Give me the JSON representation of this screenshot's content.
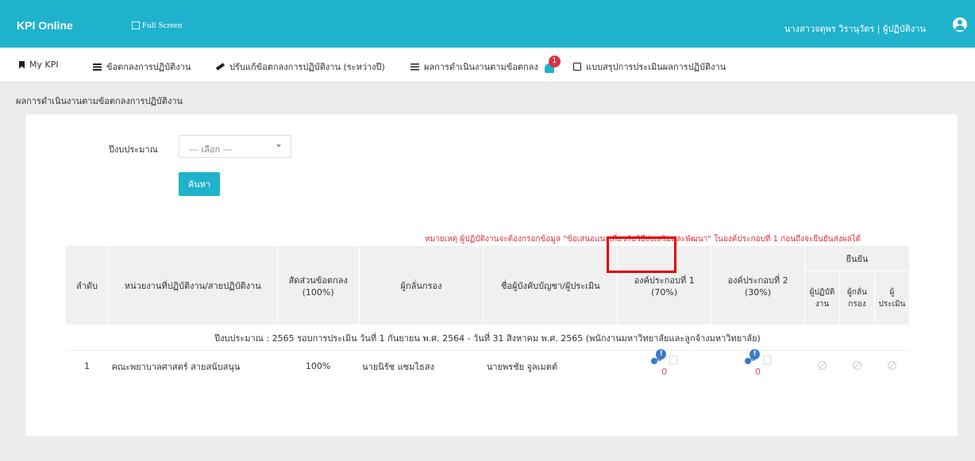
{
  "header": {
    "brand": "KPI Online",
    "fullscreen_label": "Full Screen",
    "user_name": "นางสาวจตุพร วิรานุวัตร | ผู้ปฏิบัติงาน"
  },
  "menu": [
    {
      "label": "My KPI",
      "icon": "bookmark-icon"
    },
    {
      "label": "ข้อตกลงการปฏิบัติงาน",
      "icon": "list-icon"
    },
    {
      "label": "ปรับแก้ข้อตกลงการปฏิบัติงาน (ระหว่างปี)",
      "icon": "pencil-icon"
    },
    {
      "label": "ผลการดำเนินงานตามข้อตกลง",
      "icon": "list-ul-icon",
      "badge": "1"
    },
    {
      "label": "แบบสรุปการประเมินผลการปฏิบัติงาน",
      "icon": "check-square-icon"
    }
  ],
  "page_title": "ผลการดำเนินงานตามข้อตกลงการปฏิบัติงาน",
  "form": {
    "fiscal_year_label": "ปีงบประมาณ",
    "select_placeholder": "--- เลือก ---",
    "search_label": "ค้นหา"
  },
  "remark": "หมายเหตุ ผู้ปฏิบัติงานจะต้องกรอกข้อมูล \"ข้อเสนอแนะเกี่ยวกับวิธีส่งเสริมและพัฒนา\" ในองค์ประกอบที่ 1 ก่อนถึงจะยืนยันส่งผลได้",
  "table": {
    "headers": {
      "no": "ลำดับ",
      "unit": "หน่วยงานที่ปฏิบัติงาน/สายปฏิบัติงาน",
      "ratio": "สัดส่วนข้อตกลง (100%)",
      "screener": "ผู้กลั่นกรอง",
      "supervisor": "ชื่อผู้บังคับบัญชา/ผู้ประเมิน",
      "comp1": "องค์ประกอบที่ 1 (70%)",
      "comp2": "องค์ประกอบที่ 2 (30%)",
      "confirm": "ยืนยัน",
      "confirm_worker": "ผู้ปฏิบัติงาน",
      "confirm_screener": "ผู้กลั่นกรอง",
      "confirm_evaluator": "ผู้ประเมิน"
    },
    "group_label": "ปีงบประมาณ : 2565 รอบการประเมิน วันที่ 1 กันยายน พ.ศ. 2564 - วันที่ 31 สิงหาคม พ.ศ. 2565 (พนักงานมหาวิทยาลัยและลูกจ้างมหาวิทยาลัย)",
    "rows": [
      {
        "no": "1",
        "unit": "คณะพยาบาลศาสตร์ สายสนับสนุน",
        "ratio": "100%",
        "screener": "นายนิรัช แซมไธสง",
        "supervisor": "นายพรชัย จูลเมตต์",
        "comp1_score": "0",
        "comp2_score": "0",
        "warn_badge": "!"
      }
    ]
  }
}
